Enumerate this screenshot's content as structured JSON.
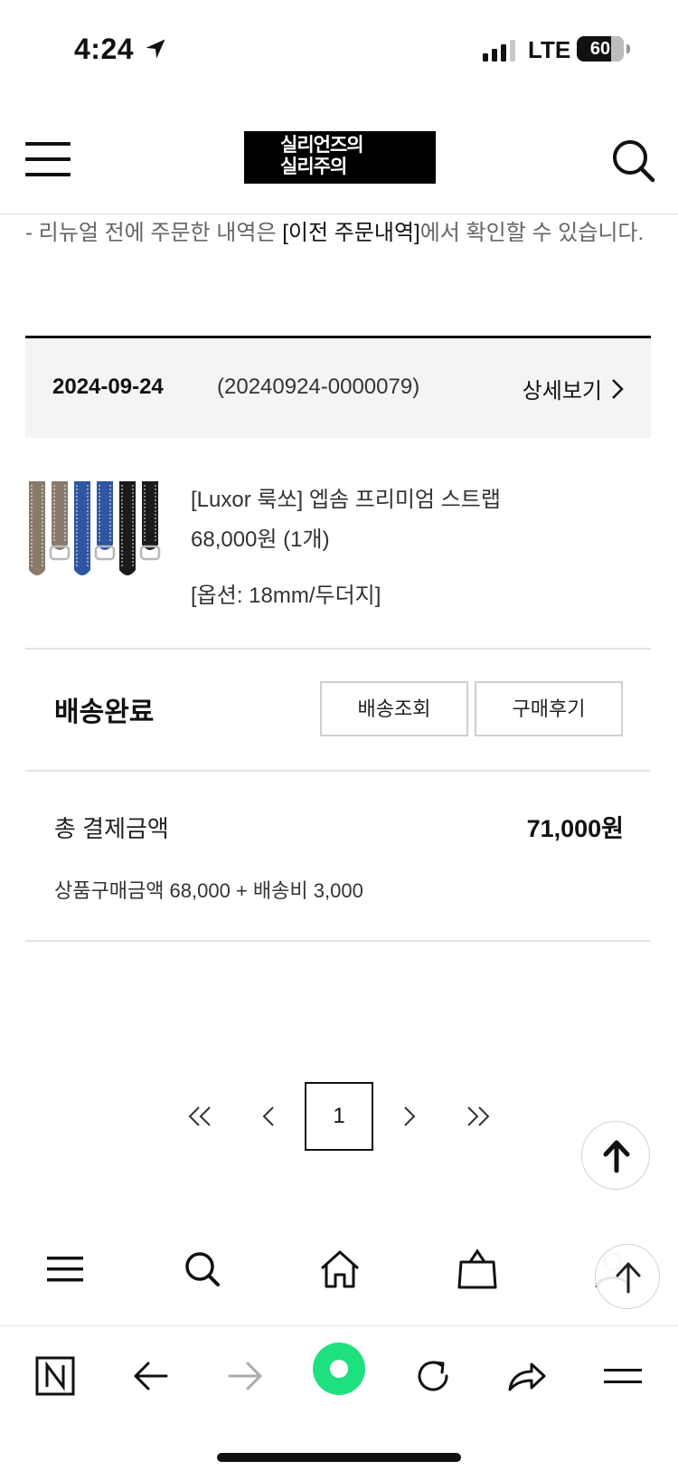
{
  "status_bar": {
    "time": "4:24",
    "network": "LTE",
    "battery": "60"
  },
  "header": {
    "logo_line1": "실리언즈의",
    "logo_line2": "실리주의",
    "icons": [
      "menu-icon",
      "search-icon"
    ]
  },
  "notice": {
    "prefix": "- 리뉴얼 전에 주문한 내역은 ",
    "link": "[이전 주문내역]",
    "suffix": "에서 확인할 수 있습니다."
  },
  "order": {
    "date": "2024-09-24",
    "number": "(20240924-0000079)",
    "detail_label": "상세보기"
  },
  "product": {
    "name": "[Luxor 룩쏘] 엡솜 프리미엄 스트랩",
    "price": "68,000원 (1개)",
    "option": "[옵션: 18mm/두더지]",
    "strap_colors": [
      "#8a7a6c",
      "#8a7a6c",
      "#2f56a3",
      "#2f56a3",
      "#1b1b1b",
      "#1b1b1b"
    ]
  },
  "delivery": {
    "status": "배송완료",
    "track_label": "배송조회",
    "review_label": "구매후기"
  },
  "payment": {
    "label": "총 결제금액",
    "total": "71,000원",
    "detail": "상품구매금액 68,000 + 배송비 3,000"
  },
  "pagination": {
    "current": "1"
  },
  "bottom_nav": [
    "menu-icon",
    "search-icon",
    "home-icon",
    "bag-icon",
    "user-icon"
  ],
  "browser_bar": [
    "naver-icon",
    "back-icon",
    "forward-icon",
    "green-dot-icon",
    "reload-icon",
    "share-icon",
    "menu-icon"
  ],
  "colors": {
    "accent_green": "#1fe07f",
    "order_head_bg": "#f4f4f4"
  }
}
